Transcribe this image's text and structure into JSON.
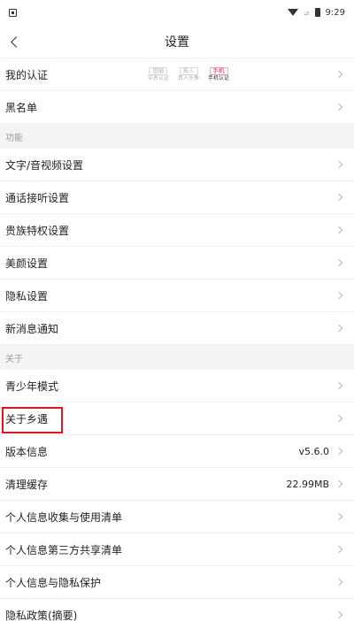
{
  "status_bar": {
    "time": "9:29"
  },
  "nav": {
    "title": "设置"
  },
  "rows": {
    "auth": {
      "label": "我的认证"
    },
    "blacklist": {
      "label": "黑名单"
    },
    "text_av": {
      "label": "文字/音视频设置"
    },
    "call": {
      "label": "通话接听设置"
    },
    "noble": {
      "label": "贵族特权设置"
    },
    "beauty": {
      "label": "美颜设置"
    },
    "privacy": {
      "label": "隐私设置"
    },
    "notify": {
      "label": "新消息通知"
    },
    "youth": {
      "label": "青少年模式"
    },
    "about_app": {
      "label": "关于乡遇"
    },
    "version": {
      "label": "版本信息",
      "value": "v5.6.0"
    },
    "cache": {
      "label": "清理缓存",
      "value": "22.99MB"
    },
    "collect": {
      "label": "个人信息收集与使用清单"
    },
    "third_party": {
      "label": "个人信息第三方共享清单"
    },
    "protect": {
      "label": "个人信息与隐私保护"
    },
    "policy": {
      "label": "隐私政策(摘要)"
    }
  },
  "sections": {
    "function": "功能",
    "about": "关于"
  },
  "auth_badges": [
    {
      "top": "国徽",
      "bottom": "实名认证",
      "active": false
    },
    {
      "top": "真人",
      "bottom": "真人头像",
      "active": false
    },
    {
      "top": "手机",
      "bottom": "手机认证",
      "active": true
    }
  ],
  "colors": {
    "highlight_box": "#e0141e",
    "section_bg": "#f4f4f4",
    "badge_active": "#e0286a"
  }
}
